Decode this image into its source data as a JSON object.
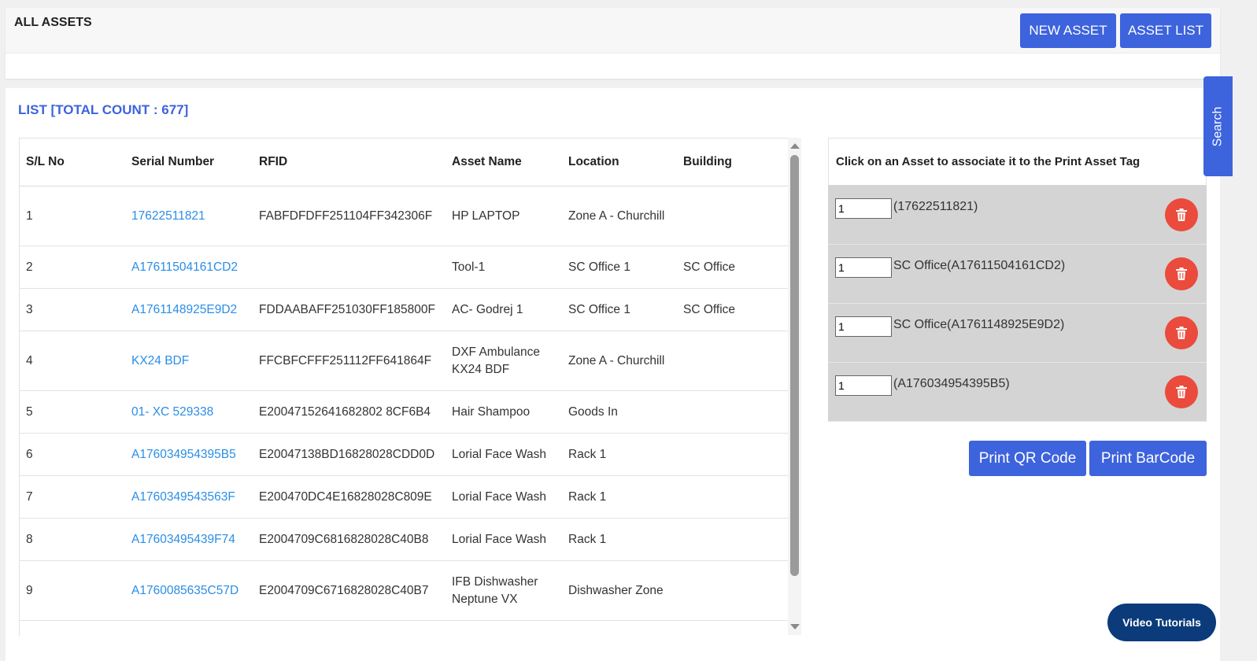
{
  "header": {
    "title": "ALL ASSETS",
    "new_asset_label": "NEW ASSET",
    "asset_list_label": "ASSET LIST"
  },
  "list": {
    "title": "LIST [TOTAL COUNT : 677]",
    "columns": [
      "S/L No",
      "Serial Number",
      "RFID",
      "Asset Name",
      "Location",
      "Building"
    ],
    "rows": [
      {
        "sl": "1",
        "serial": "17622511821",
        "rfid": "FABFDFDFF251104FF342306F",
        "name": "HP LAPTOP",
        "location": "Zone A - Churchill",
        "building": ""
      },
      {
        "sl": "2",
        "serial": "A17611504161CD2",
        "rfid": "",
        "name": "Tool-1",
        "location": "SC Office 1",
        "building": "SC Office"
      },
      {
        "sl": "3",
        "serial": "A1761148925E9D2",
        "rfid": "FDDAABAFF251030FF185800F",
        "name": "AC- Godrej 1",
        "location": "SC Office 1",
        "building": "SC Office"
      },
      {
        "sl": "4",
        "serial": "KX24 BDF",
        "rfid": "FFCBFCFFF251112FF641864F",
        "name": "DXF Ambulance KX24 BDF",
        "location": "Zone A - Churchill",
        "building": ""
      },
      {
        "sl": "5",
        "serial": "01- XC 529338",
        "rfid": "E20047152641682802 8CF6B4",
        "name": "Hair Shampoo",
        "location": "Goods In",
        "building": ""
      },
      {
        "sl": "6",
        "serial": "A176034954395B5",
        "rfid": "E20047138BD16828028CDD0D",
        "name": "Lorial Face Wash",
        "location": "Rack 1",
        "building": ""
      },
      {
        "sl": "7",
        "serial": "A1760349543563F",
        "rfid": "E200470DC4E16828028C809E",
        "name": "Lorial Face Wash",
        "location": "Rack 1",
        "building": ""
      },
      {
        "sl": "8",
        "serial": "A17603495439F74",
        "rfid": "E2004709C6816828028C40B8",
        "name": "Lorial Face Wash",
        "location": "Rack 1",
        "building": ""
      },
      {
        "sl": "9",
        "serial": "A1760085635C57D",
        "rfid": "E2004709C6716828028C40B7",
        "name": "IFB Dishwasher Neptune VX",
        "location": "Dishwasher Zone",
        "building": ""
      }
    ]
  },
  "print_panel": {
    "heading": "Click on an Asset to associate it to the Print Asset Tag",
    "items": [
      {
        "qty": "1",
        "label": "(17622511821)"
      },
      {
        "qty": "1",
        "label": "SC Office(A17611504161CD2)"
      },
      {
        "qty": "1",
        "label": "SC Office(A1761148925E9D2)"
      },
      {
        "qty": "1",
        "label": "(A176034954395B5)"
      }
    ],
    "print_qr_label": "Print QR Code",
    "print_barcode_label": "Print BarCode"
  },
  "search_tab_label": "Search",
  "video_tutorials_label": "Video Tutorials",
  "colors": {
    "primary": "#3d63dd",
    "link": "#2a8ee6",
    "delete": "#ea4b3c",
    "video_button": "#0b3b7a"
  }
}
